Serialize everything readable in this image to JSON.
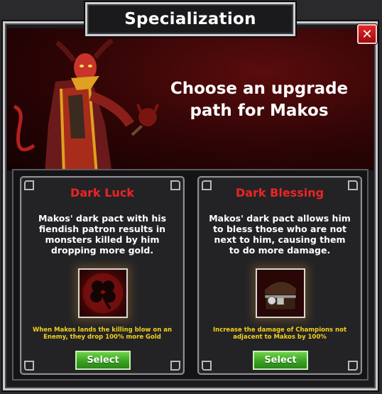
{
  "dialog": {
    "title": "Specialization",
    "close_label": "✕",
    "heading": "Choose an upgrade path for Makos"
  },
  "options": [
    {
      "title": "Dark Luck",
      "description": "Makos' dark pact with his fiendish patron results in monsters killed by him dropping more gold.",
      "icon": "clover-icon",
      "effect": "When Makos lands the killing blow on an Enemy, they drop 100% more Gold",
      "button_label": "Select"
    },
    {
      "title": "Dark Blessing",
      "description": "Makos' dark pact allows him to bless those who are not next to him, causing them to do more damage.",
      "icon": "treasure-chest-icon",
      "effect": "Increase the damage of Champions not adjacent to Makos by 100%",
      "button_label": "Select"
    }
  ],
  "colors": {
    "title_red": "#ee2424",
    "effect_yellow": "#f5d21c",
    "button_green": "#3aa323",
    "close_red": "#c8181a"
  }
}
